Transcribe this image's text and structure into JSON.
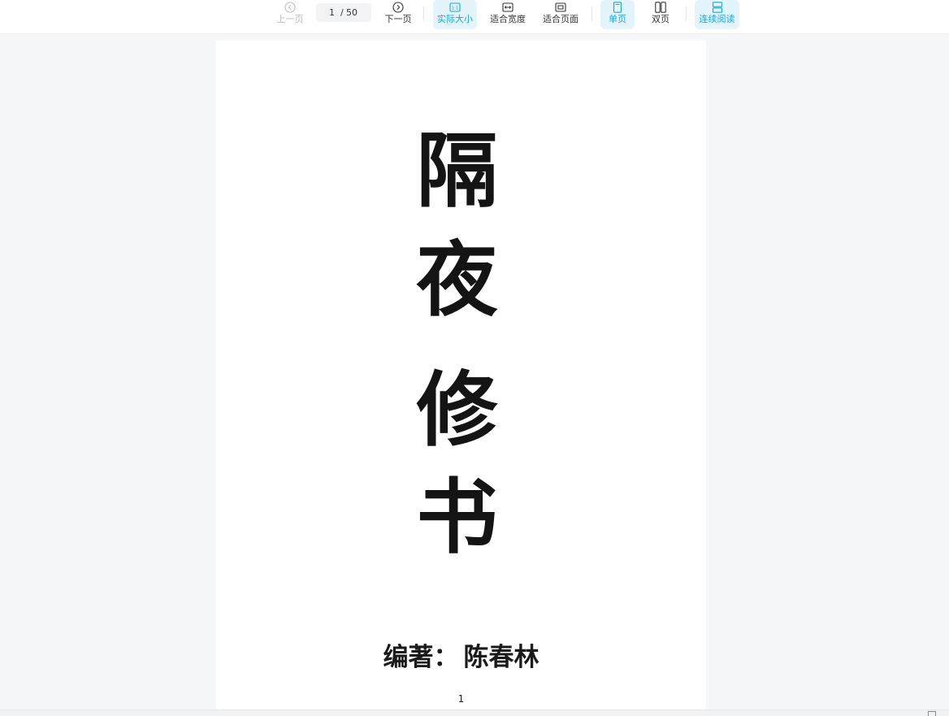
{
  "toolbar": {
    "prev_label": "上一页",
    "current_page": "1",
    "separator": "/",
    "total_pages": "50",
    "next_label": "下一页",
    "actual_size_label": "实际大小",
    "fit_width_label": "适合宽度",
    "fit_page_label": "适合页面",
    "single_page_label": "单页",
    "double_page_label": "双页",
    "continuous_label": "连续阅读",
    "icons": {
      "prev": "chevron-left-circle-icon",
      "next": "chevron-right-circle-icon",
      "actual_size": "one-to-one-icon",
      "fit_width": "fit-width-icon",
      "fit_page": "fit-page-icon",
      "single_page": "single-page-icon",
      "double_page": "double-page-icon",
      "continuous": "continuous-scroll-icon"
    },
    "accent_color": "#1aa7d7",
    "active_bg": "#e3f4fb"
  },
  "document": {
    "title_chars": [
      "隔",
      "夜",
      "修",
      "书"
    ],
    "author_label": "编著：",
    "author_name": "陈春林",
    "page_number": "1"
  }
}
